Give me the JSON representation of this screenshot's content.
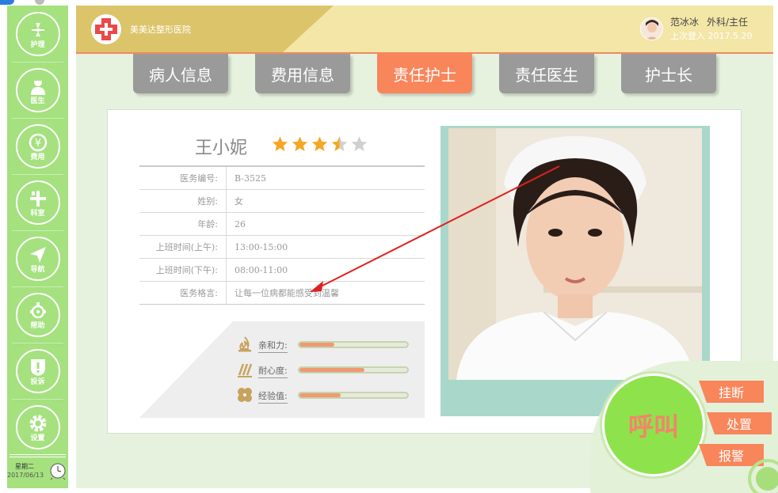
{
  "sidebar": {
    "items": [
      {
        "label": "护理",
        "icon": "nursing-icon"
      },
      {
        "label": "医生",
        "icon": "doctor-icon"
      },
      {
        "label": "费用",
        "icon": "fee-icon"
      },
      {
        "label": "科室",
        "icon": "department-icon"
      },
      {
        "label": "导航",
        "icon": "navigation-icon"
      },
      {
        "label": "帮助",
        "icon": "help-icon"
      },
      {
        "label": "投诉",
        "icon": "complaint-icon"
      },
      {
        "label": "设置",
        "icon": "settings-icon"
      }
    ],
    "weekday": "星期二",
    "date": "2017/06/13"
  },
  "header": {
    "hospital_name": "美美达整形医院",
    "user_name": "范冰冰",
    "user_role": "外科/主任",
    "last_login": "上次登入 2017.5.20"
  },
  "tabs": [
    {
      "label": "病人信息",
      "active": false
    },
    {
      "label": "费用信息",
      "active": false
    },
    {
      "label": "责任护士",
      "active": true
    },
    {
      "label": "责任医生",
      "active": false
    },
    {
      "label": "护士长",
      "active": false
    }
  ],
  "nurse": {
    "name": "王小妮",
    "rating": 3.5,
    "rating_max": 5,
    "info": [
      {
        "label": "医务编号:",
        "value": "B-3525"
      },
      {
        "label": "姓别:",
        "value": "女"
      },
      {
        "label": "年龄:",
        "value": "26"
      },
      {
        "label": "上班时间(上午):",
        "value": "13:00-15:00"
      },
      {
        "label": "上班时间(下午):",
        "value": "08:00-11:00"
      },
      {
        "label": "医务格言:",
        "value": "让每一位病都能感受到温馨"
      }
    ],
    "skills": [
      {
        "label": "亲和力:",
        "value": 0.32,
        "icon": "flame-icon"
      },
      {
        "label": "耐心度:",
        "value": 0.6,
        "icon": "patience-icon"
      },
      {
        "label": "经验值:",
        "value": 0.38,
        "icon": "experience-icon"
      }
    ]
  },
  "call": {
    "main_label": "呼叫",
    "hangup_label": "挂断",
    "handle_label": "处置",
    "alarm_label": "报警"
  },
  "colors": {
    "sidebar": "#a5e17f",
    "accent": "#f9855b",
    "header": "#f3e6a6",
    "tab_inactive": "#9a9a9a",
    "star": "#f5a623"
  }
}
